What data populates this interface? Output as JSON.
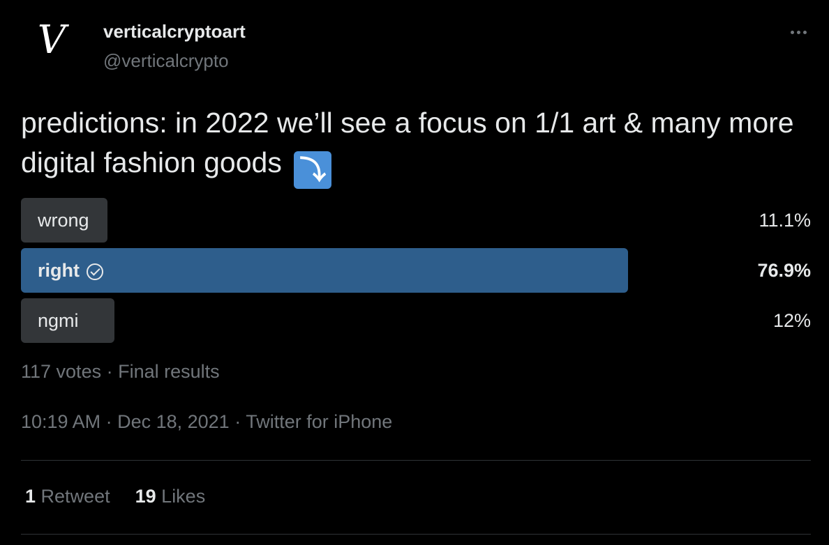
{
  "author": {
    "avatar_letter": "V",
    "display_name": "verticalcryptoart",
    "handle": "@verticalcrypto"
  },
  "tweet": {
    "text": "predictions: in 2022 we’ll see a focus on 1/1 art & many more digital fashion goods",
    "emoji": "⤵",
    "emoji_name": "right-arrow-curving-down-icon"
  },
  "poll": {
    "options": [
      {
        "label": "wrong",
        "percent_text": "11.1%",
        "percent": 11.1,
        "winner": false
      },
      {
        "label": "right",
        "percent_text": "76.9%",
        "percent": 76.9,
        "winner": true
      },
      {
        "label": "ngmi",
        "percent_text": "12%",
        "percent": 12,
        "winner": false
      }
    ],
    "summary": "117 votes · Final results"
  },
  "meta": {
    "timestamp": "10:19 AM · Dec 18, 2021 · Twitter for iPhone"
  },
  "stats": {
    "retweets_count": "1",
    "retweets_label": "Retweet",
    "likes_count": "19",
    "likes_label": "Likes"
  },
  "colors": {
    "background": "#000000",
    "text": "#e7e9ea",
    "secondary_text": "#71767b",
    "poll_bar": "#333639",
    "poll_winner_bar": "#2e5e8c",
    "emoji_bg": "#4a90d9"
  }
}
